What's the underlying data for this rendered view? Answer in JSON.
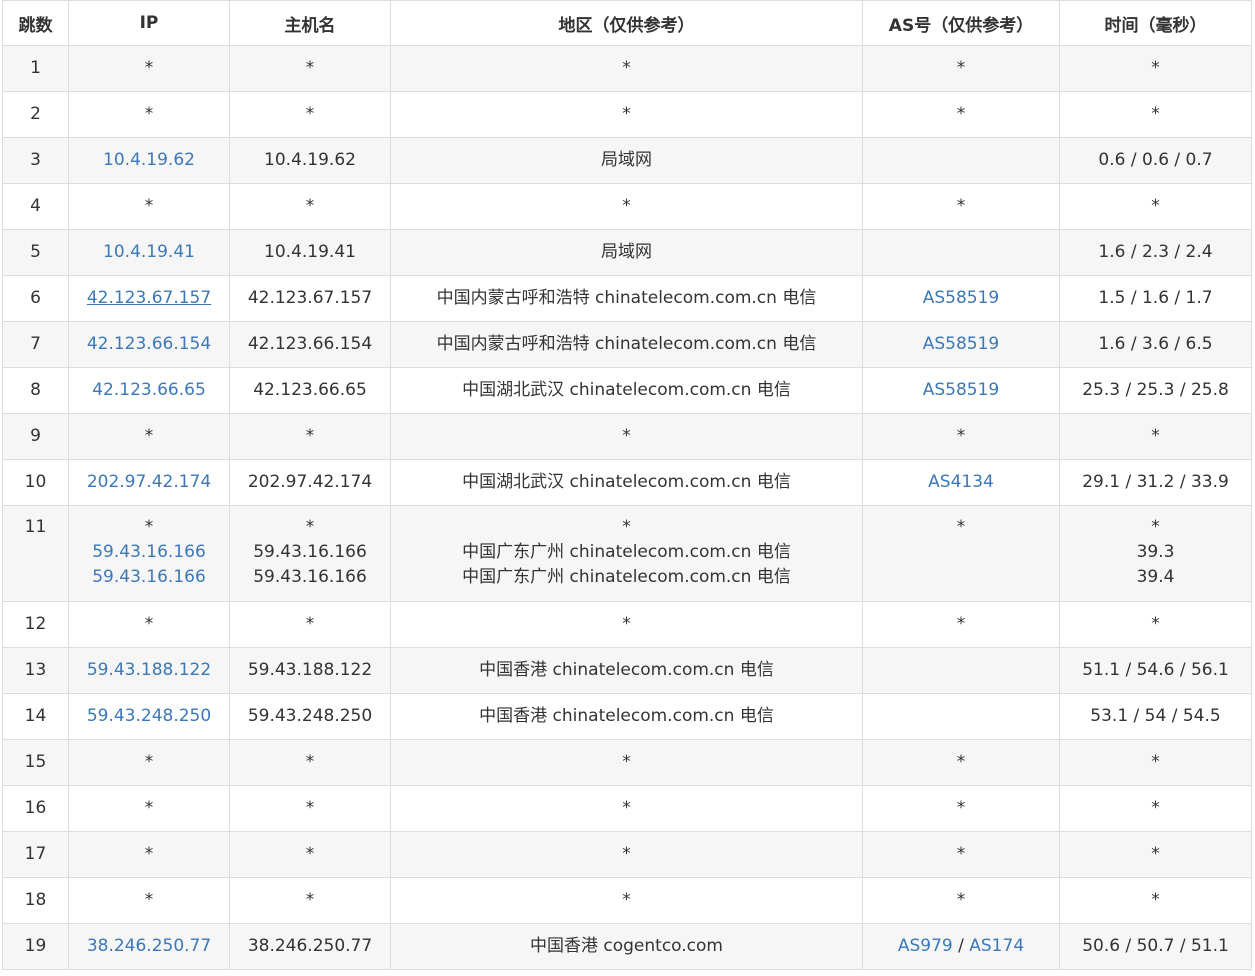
{
  "colors": {
    "link": "#3b78b8",
    "text": "#333333",
    "border": "#dddddd",
    "row_alt": "#f6f6f6"
  },
  "headers": {
    "hop": "跳数",
    "ip": "IP",
    "host": "主机名",
    "region": "地区（仅供参考）",
    "as": "AS号（仅供参考）",
    "time": "时间（毫秒）"
  },
  "rows": [
    {
      "hop": "1",
      "ip": "*",
      "host": "*",
      "region": "*",
      "as": "*",
      "time": "*"
    },
    {
      "hop": "2",
      "ip": "*",
      "host": "*",
      "region": "*",
      "as": "*",
      "time": "*"
    },
    {
      "hop": "3",
      "ip": "10.4.19.62",
      "host": "10.4.19.62",
      "region": "局域网",
      "as": "",
      "time": "0.6 / 0.6 / 0.7"
    },
    {
      "hop": "4",
      "ip": "*",
      "host": "*",
      "region": "*",
      "as": "*",
      "time": "*"
    },
    {
      "hop": "5",
      "ip": "10.4.19.41",
      "host": "10.4.19.41",
      "region": "局域网",
      "as": "",
      "time": "1.6 / 2.3 / 2.4"
    },
    {
      "hop": "6",
      "ip": "42.123.67.157",
      "host": "42.123.67.157",
      "region": "中国内蒙古呼和浩特 chinatelecom.com.cn 电信",
      "as": "AS58519",
      "time": "1.5 / 1.6 / 1.7"
    },
    {
      "hop": "7",
      "ip": "42.123.66.154",
      "host": "42.123.66.154",
      "region": "中国内蒙古呼和浩特 chinatelecom.com.cn 电信",
      "as": "AS58519",
      "time": "1.6 / 3.6 / 6.5"
    },
    {
      "hop": "8",
      "ip": "42.123.66.65",
      "host": "42.123.66.65",
      "region": "中国湖北武汉 chinatelecom.com.cn 电信",
      "as": "AS58519",
      "time": "25.3 / 25.3 / 25.8"
    },
    {
      "hop": "9",
      "ip": "*",
      "host": "*",
      "region": "*",
      "as": "*",
      "time": "*"
    },
    {
      "hop": "10",
      "ip": "202.97.42.174",
      "host": "202.97.42.174",
      "region": "中国湖北武汉 chinatelecom.com.cn 电信",
      "as": "AS4134",
      "time": "29.1 / 31.2 / 33.9"
    },
    {
      "hop": "11",
      "ip_lines": [
        "*",
        "59.43.16.166",
        "59.43.16.166"
      ],
      "host_lines": [
        "*",
        "59.43.16.166",
        "59.43.16.166"
      ],
      "region_lines": [
        "*",
        "中国广东广州 chinatelecom.com.cn 电信",
        "中国广东广州 chinatelecom.com.cn 电信"
      ],
      "as": "*",
      "time_lines": [
        "*",
        "39.3",
        "39.4"
      ]
    },
    {
      "hop": "12",
      "ip": "*",
      "host": "*",
      "region": "*",
      "as": "*",
      "time": "*"
    },
    {
      "hop": "13",
      "ip": "59.43.188.122",
      "host": "59.43.188.122",
      "region": "中国香港 chinatelecom.com.cn 电信",
      "as": "",
      "time": "51.1 / 54.6 / 56.1"
    },
    {
      "hop": "14",
      "ip": "59.43.248.250",
      "host": "59.43.248.250",
      "region": "中国香港 chinatelecom.com.cn 电信",
      "as": "",
      "time": "53.1 / 54 / 54.5"
    },
    {
      "hop": "15",
      "ip": "*",
      "host": "*",
      "region": "*",
      "as": "*",
      "time": "*"
    },
    {
      "hop": "16",
      "ip": "*",
      "host": "*",
      "region": "*",
      "as": "*",
      "time": "*"
    },
    {
      "hop": "17",
      "ip": "*",
      "host": "*",
      "region": "*",
      "as": "*",
      "time": "*"
    },
    {
      "hop": "18",
      "ip": "*",
      "host": "*",
      "region": "*",
      "as": "*",
      "time": "*"
    },
    {
      "hop": "19",
      "ip": "38.246.250.77",
      "host": "38.246.250.77",
      "region": "中国香港 cogentco.com",
      "as_parts": [
        "AS979",
        "/",
        "AS174"
      ],
      "time": "50.6 / 50.7 / 51.1"
    }
  ]
}
